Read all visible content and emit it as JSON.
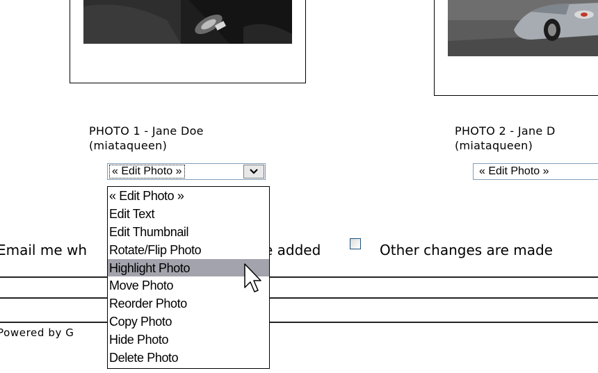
{
  "photos": [
    {
      "caption_line1": "PHOTO 1 - Jane Doe",
      "caption_line2": "(miataqueen)",
      "select_value": "« Edit Photo »"
    },
    {
      "caption_line1": "PHOTO 2 - Jane D",
      "caption_line2": "(miataqueen)",
      "select_value": "« Edit Photo »"
    }
  ],
  "dropdown_options": [
    "« Edit Photo »",
    "Edit Text",
    "Edit Thumbnail",
    "Rotate/Flip Photo",
    "Highlight Photo",
    "Move Photo",
    "Reorder Photo",
    "Copy Photo",
    "Hide Photo",
    "Delete Photo"
  ],
  "highlighted_option": "Highlight Photo",
  "notify": {
    "left_text": "Email me wh",
    "middle_text": "e added",
    "other_changes_label": "Other changes are made"
  },
  "footer": {
    "powered_by": "Powered by G"
  },
  "colors": {
    "highlight": "#a3a3ad",
    "select_border": "#7f9db9"
  },
  "icons": {
    "select_arrow": "chevron-down-icon",
    "cursor": "mouse-pointer-icon"
  }
}
